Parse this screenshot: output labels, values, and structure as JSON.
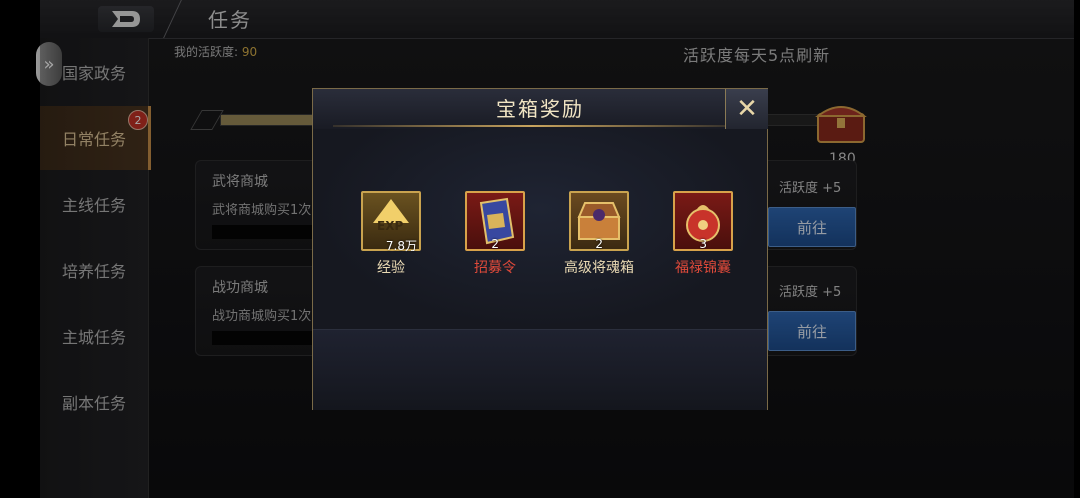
{
  "page": {
    "title": "任务",
    "my_activity_label": "我的活跃度:",
    "my_activity_value": "90",
    "refresh_note": "活跃度每天5点刷新",
    "progress_fraction": 0.5,
    "chest_value": "180"
  },
  "sidebar": {
    "items": [
      {
        "label": "国家政务"
      },
      {
        "label": "日常任务",
        "badge": "2"
      },
      {
        "label": "主线任务"
      },
      {
        "label": "培养任务"
      },
      {
        "label": "主城任务"
      },
      {
        "label": "副本任务"
      }
    ]
  },
  "tasks": [
    {
      "title": "武将商城",
      "desc": "武将商城购买1次",
      "reward": "活跃度 +5",
      "button": "前往"
    },
    {
      "title": "战功商城",
      "desc": "战功商城购买1次",
      "reward": "活跃度 +5",
      "button": "前往"
    }
  ],
  "modal": {
    "title": "宝箱奖励",
    "close_glyph": "✕",
    "rewards": [
      {
        "name": "经验",
        "count": "7.8万",
        "icon": "exp-icon",
        "icon_text": "EXP",
        "name_color": "#e9d9b3"
      },
      {
        "name": "招募令",
        "count": "2",
        "icon": "recruit-order-icon",
        "name_color": "#e04a3a"
      },
      {
        "name": "高级将魂箱",
        "count": "2",
        "icon": "soul-chest-icon",
        "name_color": "#e9d9b3"
      },
      {
        "name": "福禄锦囊",
        "count": "3",
        "icon": "fortune-pouch-icon",
        "name_color": "#e04a3a"
      }
    ]
  },
  "colors": {
    "accent_gold": "#c9a34f",
    "go_button": "#2f68b4",
    "red_text": "#e04a3a"
  }
}
